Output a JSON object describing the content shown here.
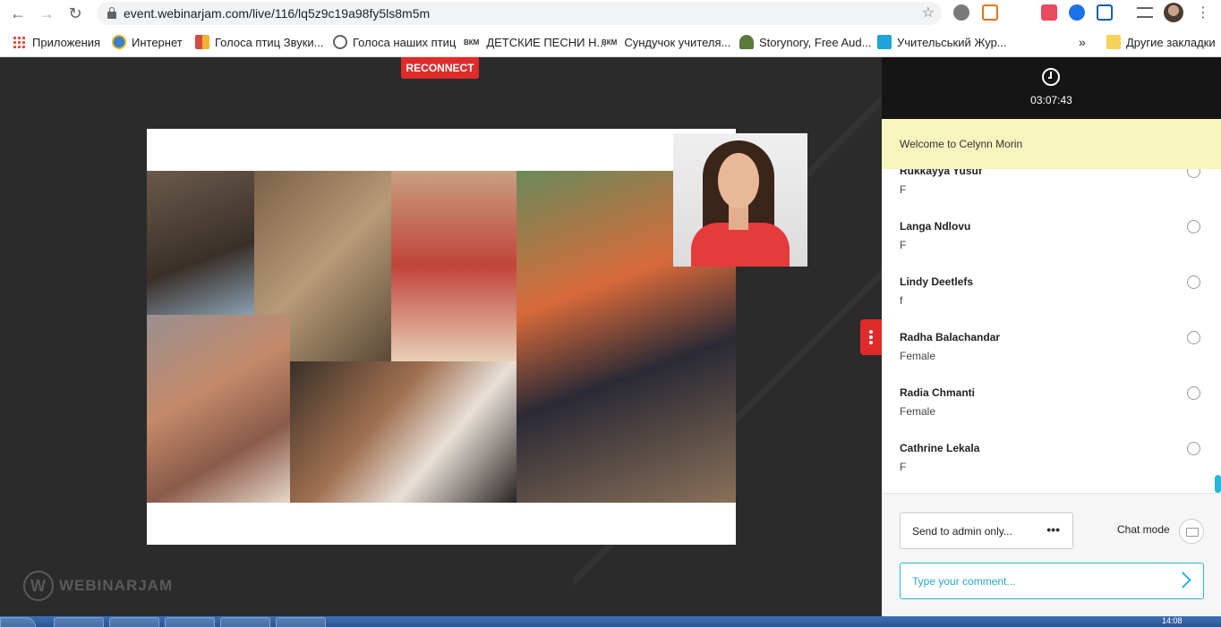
{
  "browser": {
    "url": "event.webinarjam.com/live/116/lq5z9c19a98fy5ls8m5m",
    "extension_colors": [
      "#7a7a7a",
      "#e8711c",
      "#e84a5f",
      "#1a73e8",
      "#5f6368"
    ]
  },
  "bookmarks": {
    "items": [
      {
        "label": "Приложения",
        "icon": "apps-grid-icon"
      },
      {
        "label": "Интернет",
        "icon": "globe-icon",
        "color": "#3b7fd4"
      },
      {
        "label": "Голоса птиц Звуки...",
        "icon": "puzzle-icon",
        "color": "#d94b3f"
      },
      {
        "label": "Голоса наших птиц",
        "icon": "globe-icon",
        "color": "#5f6368"
      },
      {
        "label": "ДЕТСКИЕ ПЕСНИ Н...",
        "icon_text": "ВКМ"
      },
      {
        "label": "Сундучок учителя...",
        "icon_text": "ВКМ"
      },
      {
        "label": "Storynory, Free Aud...",
        "icon": "tree-icon",
        "color": "#5a7a3a"
      },
      {
        "label": "Учительський Жур...",
        "icon": "book-icon",
        "color": "#1fa3d8"
      }
    ],
    "more": "»",
    "other_label": "Другие закладки"
  },
  "stage": {
    "reconnect_label": "RECONNECT",
    "logo_text": "WEBINARJAM",
    "photo_colors": [
      "#5a4a3a",
      "#8a6a4a",
      "#c47a4a",
      "#6a7a4a",
      "#9a7a6a",
      "#3a3030"
    ]
  },
  "panel": {
    "timer": "03:07:43",
    "welcome": "Welcome to Celynn Morin",
    "attendees": [
      {
        "name": "Rukkayya Yusuf",
        "gender": "F"
      },
      {
        "name": "Langa Ndlovu",
        "gender": "F"
      },
      {
        "name": "Lindy Deetlefs",
        "gender": "f"
      },
      {
        "name": "Radha Balachandar",
        "gender": "Female"
      },
      {
        "name": "Radia Chmanti",
        "gender": "Female"
      },
      {
        "name": "Cathrine Lekala",
        "gender": "F"
      }
    ],
    "send_mode": "Send to admin only...",
    "send_more": "•••",
    "chat_mode_label": "Chat mode",
    "comment_placeholder": "Type your comment..."
  },
  "taskbar": {
    "time": "14:08"
  }
}
